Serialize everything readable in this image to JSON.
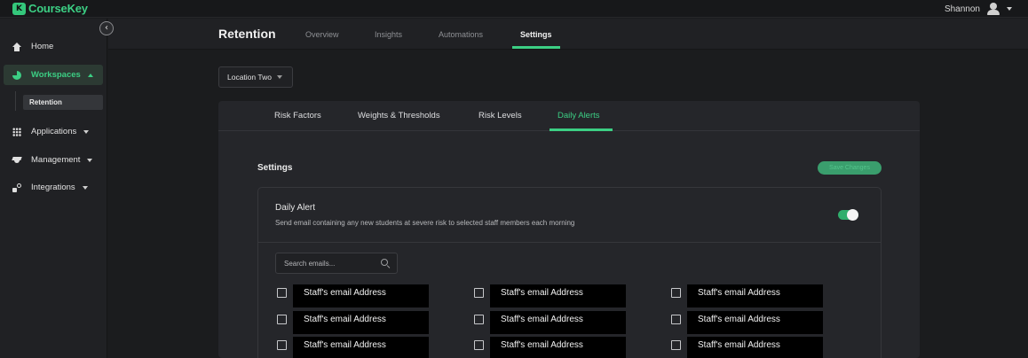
{
  "app": {
    "logo_mark": "K",
    "logo_text": "CourseKey"
  },
  "user": {
    "name": "Shannon"
  },
  "sidebar": {
    "collapse_glyph": "‹",
    "items": [
      {
        "label": "Home",
        "icon": "home-icon"
      },
      {
        "label": "Workspaces",
        "icon": "pie-chart-icon"
      },
      {
        "label": "Applications",
        "icon": "grid-icon"
      },
      {
        "label": "Management",
        "icon": "graduation-cap-icon"
      },
      {
        "label": "Integrations",
        "icon": "integrations-icon"
      }
    ],
    "sub_item": "Retention"
  },
  "header": {
    "title": "Retention",
    "tabs": [
      "Overview",
      "Insights",
      "Automations",
      "Settings"
    ],
    "active_tab": "Settings"
  },
  "location_select": {
    "value": "Location Two"
  },
  "subtabs": {
    "items": [
      "Risk Factors",
      "Weights & Thresholds",
      "Risk Levels",
      "Daily Alerts"
    ],
    "active": "Daily Alerts"
  },
  "settings": {
    "title": "Settings",
    "save_label": "Save Changes"
  },
  "daily_alert": {
    "title": "Daily Alert",
    "description": "Send email containing any new students at severe risk to selected staff members each morning",
    "enabled": true
  },
  "search": {
    "placeholder": "Search emails..."
  },
  "emails": {
    "rows": [
      [
        "Staff's email Address",
        "Staff's email Address",
        "Staff's email Address"
      ],
      [
        "Staff's email Address",
        "Staff's email Address",
        "Staff's email Address"
      ],
      [
        "Staff's email Address",
        "Staff's email Address",
        "Staff's email Address"
      ]
    ]
  },
  "colors": {
    "accent": "#3ccf84",
    "background": "#1b1c1e",
    "panel": "#25262a"
  }
}
